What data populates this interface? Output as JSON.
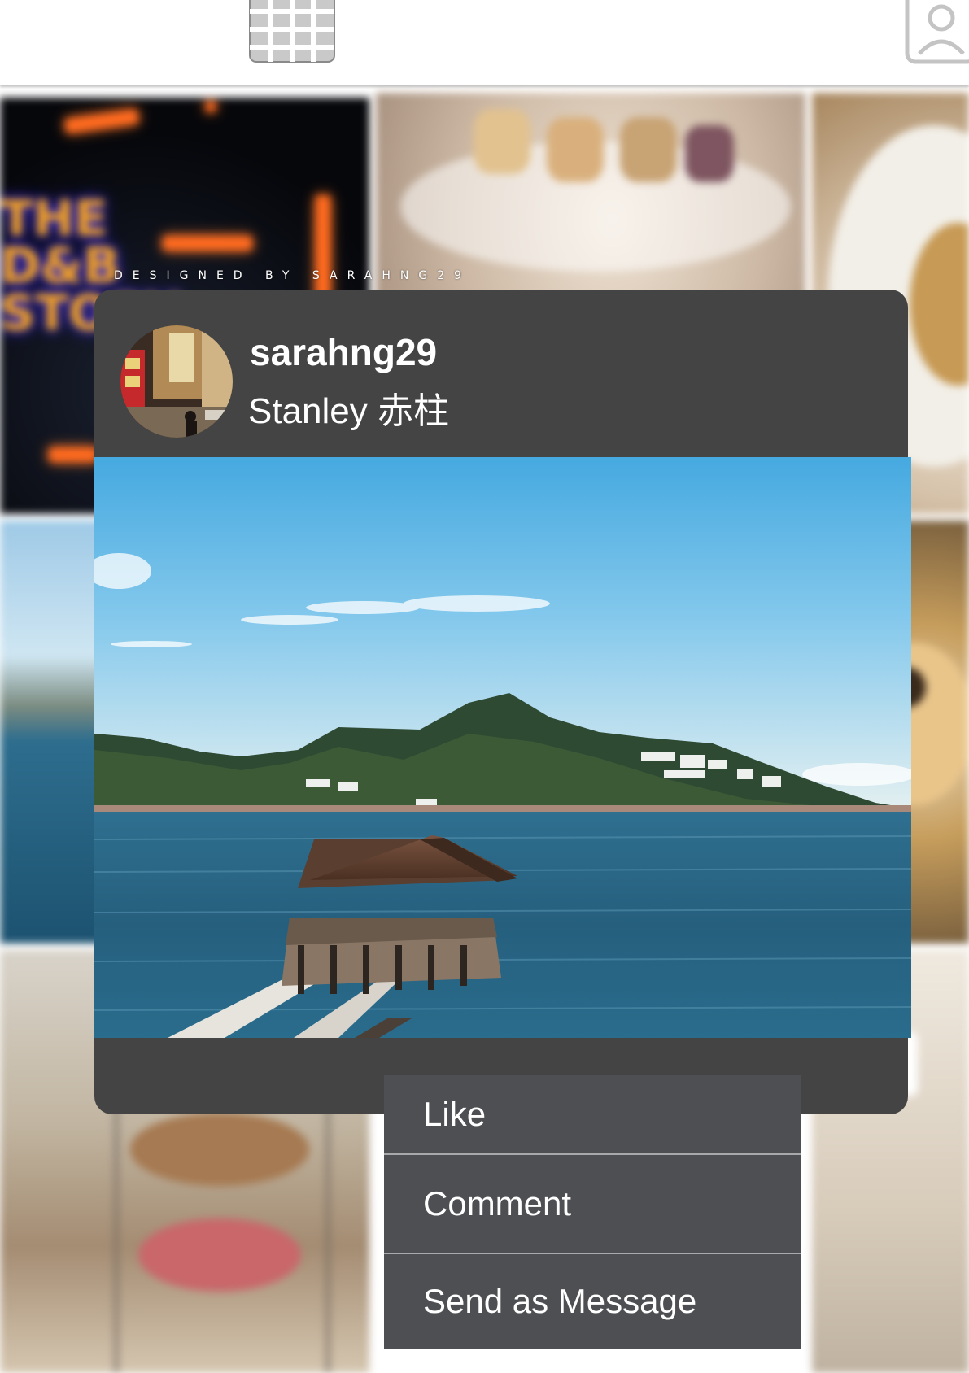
{
  "topbar": {
    "tabs": [
      {
        "icon": "grid-icon"
      },
      {
        "icon": "user-profile-icon"
      }
    ]
  },
  "background": {
    "tiles": [
      {
        "subject": "neon-sign",
        "sign_text": "THE D&B STORY"
      },
      {
        "subject": "afternoon-tea-stand"
      },
      {
        "subject": "plated-food"
      },
      {
        "subject": "seaside-view"
      },
      {
        "subject": "pastries"
      },
      {
        "subject": "tiered-cake-stand"
      },
      {
        "subject": "table-setting"
      }
    ]
  },
  "watermark": "DESIGNED BY SARAHNG29",
  "post": {
    "username": "sarahng29",
    "location": "Stanley 赤柱",
    "avatar_icon": "street-scene-avatar",
    "photo_subject": "Blake Pier at Stanley with sea and hills"
  },
  "actions": {
    "like": "Like",
    "comment": "Comment",
    "send": "Send as Message"
  },
  "colors": {
    "card_background": "#444444",
    "menu_background": "#4d4f52",
    "menu_divider": "#a7a9ab",
    "text": "#ffffff"
  }
}
